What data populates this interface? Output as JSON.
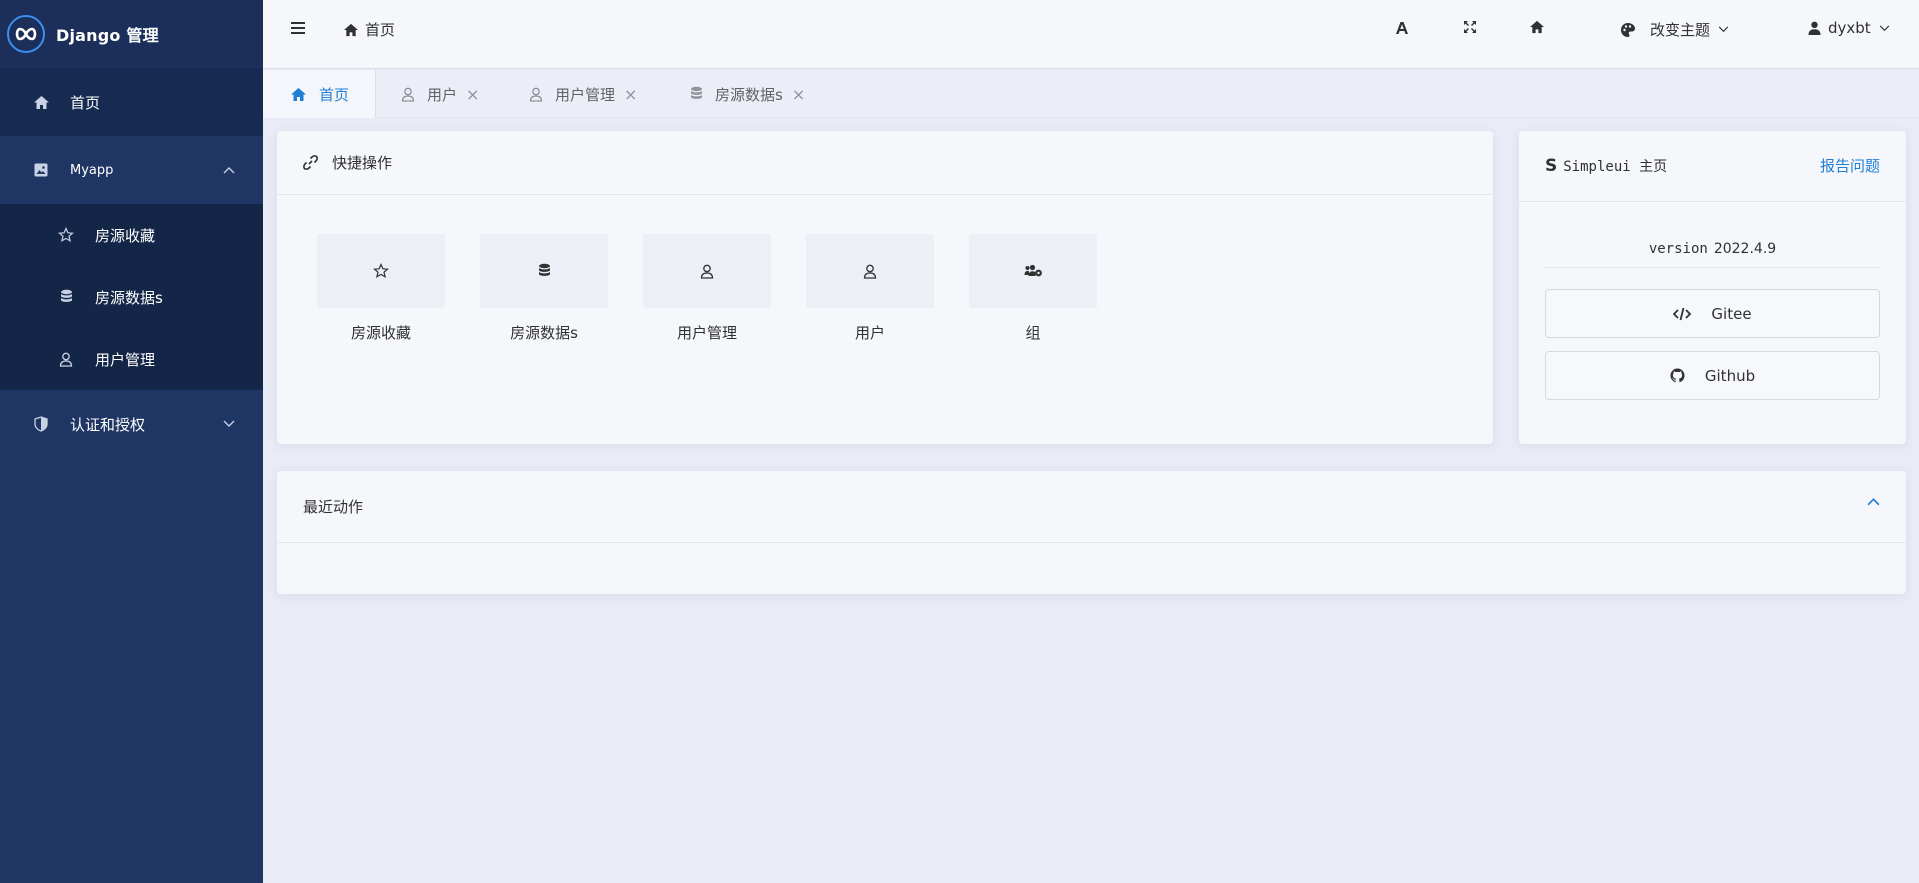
{
  "app": {
    "title": "Django 管理",
    "accent": "#1f7fd6",
    "sidebar_bg": "#1f3564"
  },
  "sidebar": {
    "home": {
      "label": "首页",
      "icon": "home-icon"
    },
    "groups": [
      {
        "label": "Myapp",
        "icon": "image-icon",
        "expanded": true,
        "items": [
          {
            "label": "房源收藏",
            "icon": "star-icon"
          },
          {
            "label": "房源数据s",
            "icon": "database-icon"
          },
          {
            "label": "用户管理",
            "icon": "user-icon"
          }
        ]
      },
      {
        "label": "认证和授权",
        "icon": "shield-icon",
        "expanded": false
      }
    ]
  },
  "header": {
    "breadcrumb": "首页",
    "font_icon": "font-icon",
    "fullscreen_icon": "expand-icon",
    "home_icon": "home-icon",
    "theme_label": "改变主题",
    "user_name": "dyxbt"
  },
  "tabs": [
    {
      "label": "首页",
      "icon": "home-icon",
      "active": true,
      "closable": false
    },
    {
      "label": "用户",
      "icon": "user-icon",
      "active": false,
      "closable": true
    },
    {
      "label": "用户管理",
      "icon": "user-icon",
      "active": false,
      "closable": true
    },
    {
      "label": "房源数据s",
      "icon": "database-icon",
      "active": false,
      "closable": true
    }
  ],
  "quick_actions": {
    "title": "快捷操作",
    "items": [
      {
        "label": "房源收藏",
        "icon": "star-icon"
      },
      {
        "label": "房源数据s",
        "icon": "database-icon"
      },
      {
        "label": "用户管理",
        "icon": "user-icon"
      },
      {
        "label": "用户",
        "icon": "user-icon"
      },
      {
        "label": "组",
        "icon": "users-cog-icon"
      }
    ]
  },
  "simpleui": {
    "title": "Simpleui 主页",
    "report_link": "报告问题",
    "version_label": "version",
    "version_value": "2022.4.9",
    "gitee_label": "Gitee",
    "github_label": "Github"
  },
  "recent_actions": {
    "title": "最近动作"
  }
}
